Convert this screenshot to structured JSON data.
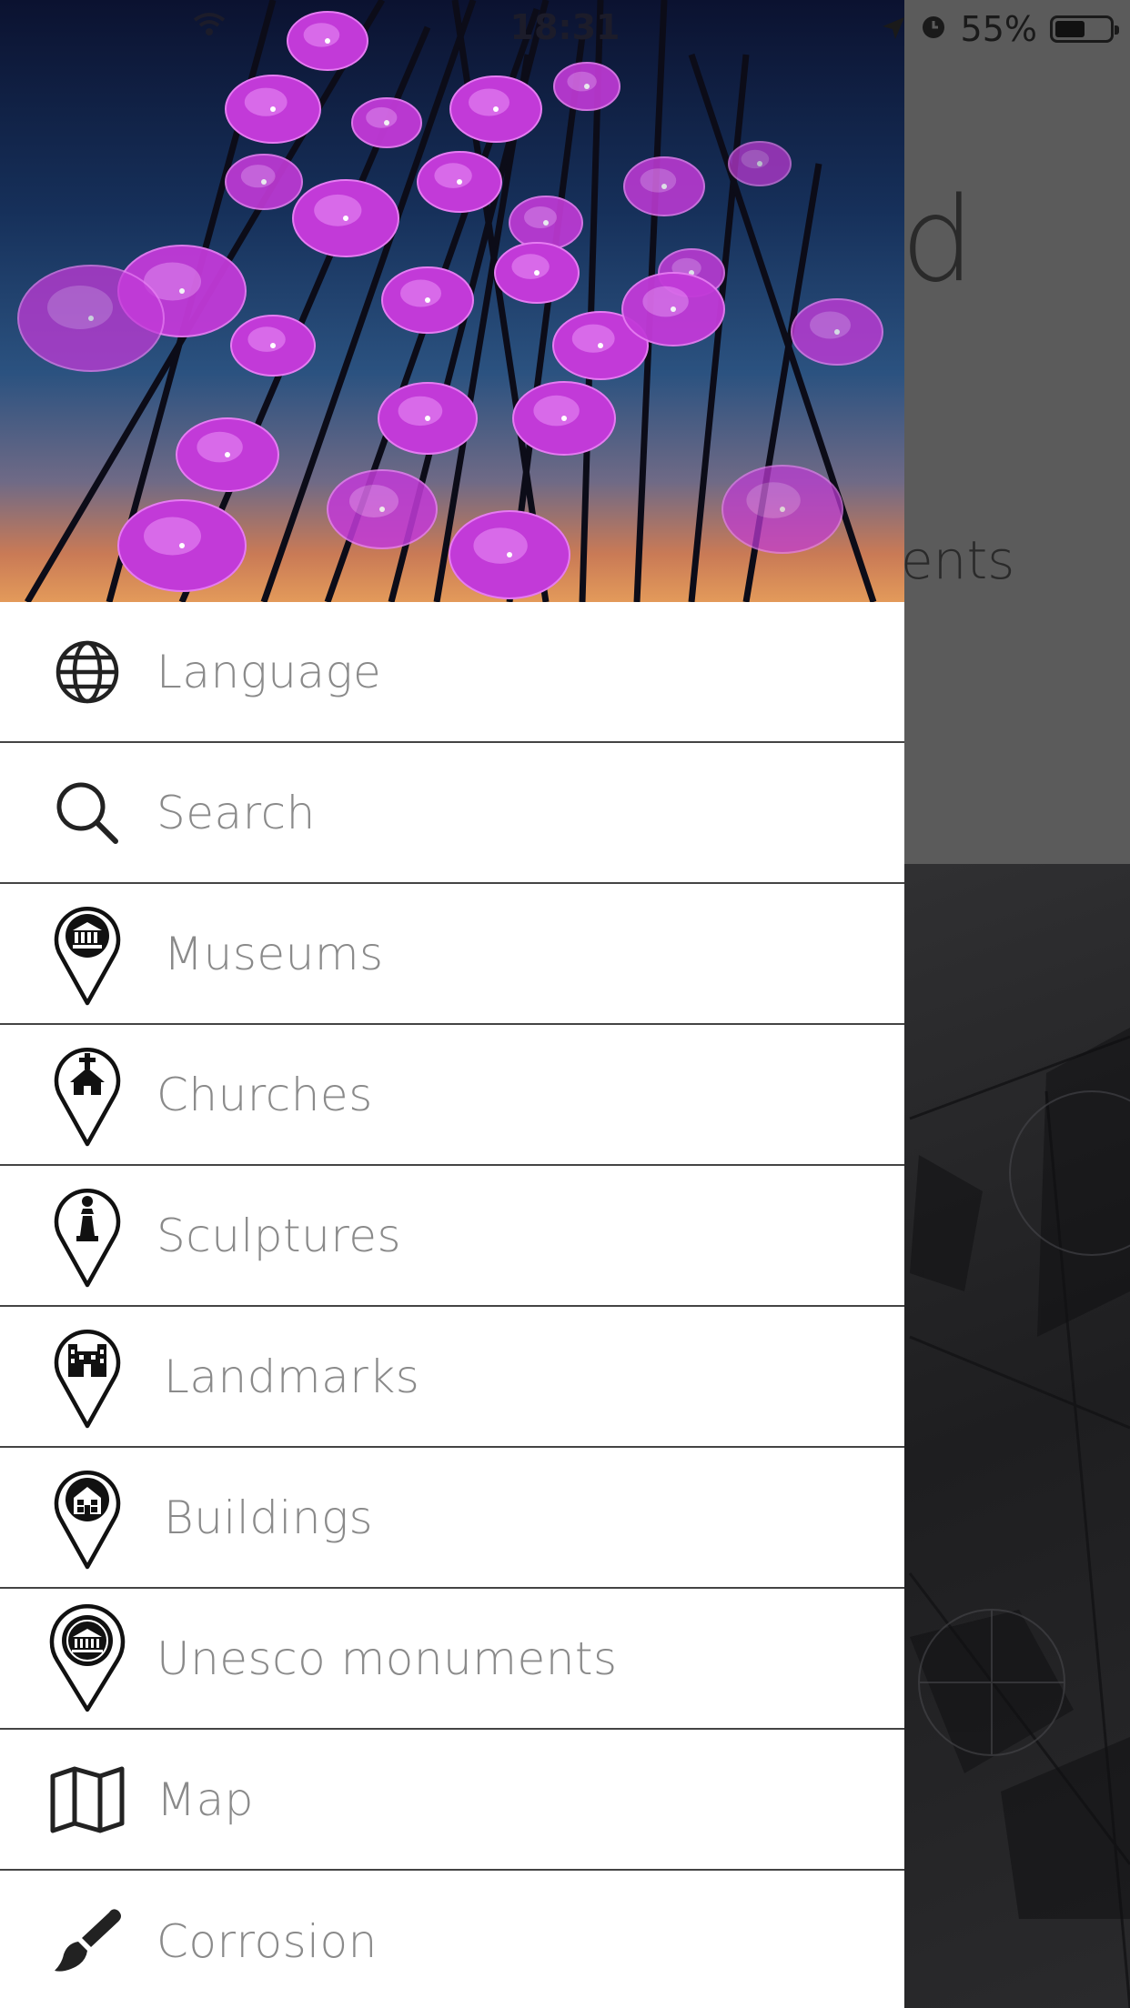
{
  "status_bar": {
    "time": "18:31",
    "battery": "55%",
    "battery_level": 0.55
  },
  "background": {
    "partial_title": "d",
    "partial_text": "ents"
  },
  "colors": {
    "menu_text": "#8a8a8a",
    "divider": "#444444",
    "umbrella_accent": "#c23ad8"
  },
  "menu": {
    "items": [
      {
        "label": "Language",
        "icon": "globe-icon"
      },
      {
        "label": "Search",
        "icon": "search-icon"
      },
      {
        "label": "Museums",
        "icon": "museum-pin-icon"
      },
      {
        "label": "Churches",
        "icon": "church-pin-icon"
      },
      {
        "label": "Sculptures",
        "icon": "sculpture-pin-icon"
      },
      {
        "label": "Landmarks",
        "icon": "landmark-pin-icon"
      },
      {
        "label": "Buildings",
        "icon": "building-pin-icon"
      },
      {
        "label": "Unesco monuments",
        "icon": "unesco-pin-icon"
      },
      {
        "label": "Map",
        "icon": "map-icon"
      },
      {
        "label": "Corrosion",
        "icon": "paintbrush-icon"
      }
    ]
  }
}
